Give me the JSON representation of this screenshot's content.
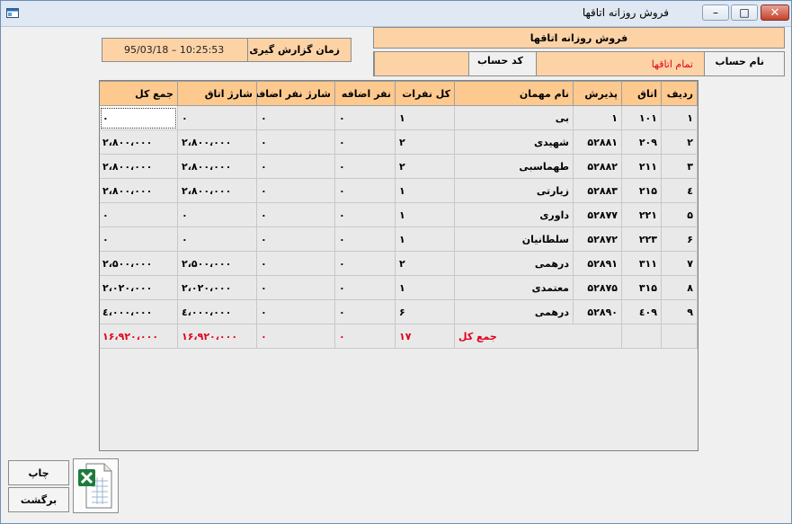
{
  "window": {
    "title": "فروش روزانه اتاقها",
    "minimize_glyph": "–",
    "restore_glyph": "□",
    "close_glyph": "✕"
  },
  "header": {
    "report_title": "فروش روزانه اتاقها",
    "report_time_label": "زمان گزارش گیری",
    "report_time_value": "95/03/18 – 10:25:53",
    "account_name_label": "نام حساب",
    "account_name_value": "تمام اتاقها",
    "account_code_label": "کد حساب",
    "account_code_value": ""
  },
  "table": {
    "columns": [
      "ردیف",
      "اتاق",
      "پذیرش",
      "نام مهمان",
      "کل نفرات",
      "نفر اضافه",
      "شارژ نفر اضافه",
      "شارژ اتاق",
      "جمع کل"
    ],
    "rows": [
      [
        "۱",
        "۱۰۱",
        "۱",
        "بی",
        "۱",
        "۰",
        "۰",
        "۰",
        "۰"
      ],
      [
        "۲",
        "۲۰۹",
        "۵۲۸۸۱",
        "شهیدی",
        "۲",
        "۰",
        "۰",
        "۲،۸۰۰،۰۰۰",
        "۲،۸۰۰،۰۰۰"
      ],
      [
        "۳",
        "۲۱۱",
        "۵۲۸۸۲",
        "طهماسبی",
        "۲",
        "۰",
        "۰",
        "۲،۸۰۰،۰۰۰",
        "۲،۸۰۰،۰۰۰"
      ],
      [
        "٤",
        "۲۱۵",
        "۵۲۸۸۳",
        "زیارتی",
        "۱",
        "۰",
        "۰",
        "۲،۸۰۰،۰۰۰",
        "۲،۸۰۰،۰۰۰"
      ],
      [
        "۵",
        "۲۲۱",
        "۵۲۸۷۷",
        "داوری",
        "۱",
        "۰",
        "۰",
        "۰",
        "۰"
      ],
      [
        "۶",
        "۲۲۳",
        "۵۲۸۷۲",
        "سلطانیان",
        "۱",
        "۰",
        "۰",
        "۰",
        "۰"
      ],
      [
        "۷",
        "۳۱۱",
        "۵۲۸۹۱",
        "درهمی",
        "۲",
        "۰",
        "۰",
        "۲،۵۰۰،۰۰۰",
        "۲،۵۰۰،۰۰۰"
      ],
      [
        "۸",
        "۳۱۵",
        "۵۲۸۷۵",
        "معتمدی",
        "۱",
        "۰",
        "۰",
        "۲،۰۲۰،۰۰۰",
        "۲،۰۲۰،۰۰۰"
      ],
      [
        "۹",
        "٤۰۹",
        "۵۲۸۹۰",
        "درهمی",
        "۶",
        "۰",
        "۰",
        "٤،۰۰۰،۰۰۰",
        "٤،۰۰۰،۰۰۰"
      ]
    ],
    "total": {
      "label": "جمع کل",
      "persons": "۱۷",
      "extra_persons": "۰",
      "extra_charge": "۰",
      "room_charge": "۱۶،۹۲۰،۰۰۰",
      "grand_total": "۱۶،۹۲۰،۰۰۰"
    }
  },
  "buttons": {
    "print": "چاپ",
    "back": "برگشت"
  },
  "colors": {
    "header_orange": "#fdc98e",
    "panel_orange": "#fdd3a6",
    "total_red": "#e4001b"
  }
}
